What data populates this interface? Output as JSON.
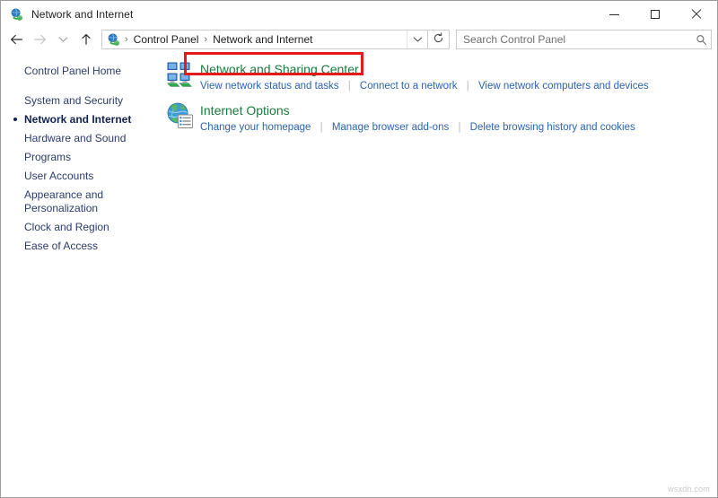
{
  "window": {
    "title": "Network and Internet",
    "title_icon": "network-globe-icon",
    "controls": {
      "minimize_label": "Minimize",
      "maximize_label": "Maximize",
      "close_label": "Close"
    }
  },
  "navbar": {
    "back_label": "Back",
    "forward_label": "Forward",
    "recent_label": "Recent locations",
    "up_label": "Up one level",
    "breadcrumb": {
      "icon": "network-globe-icon",
      "separator": "›",
      "items": [
        "Control Panel",
        "Network and Internet"
      ]
    },
    "address_dropdown_label": "Previous locations",
    "refresh_label": "Refresh",
    "search": {
      "placeholder": "Search Control Panel",
      "value": "",
      "icon": "search-icon"
    }
  },
  "sidebar": {
    "items": [
      {
        "label": "Control Panel Home",
        "current": false
      },
      {
        "label": "System and Security",
        "current": false
      },
      {
        "label": "Network and Internet",
        "current": true
      },
      {
        "label": "Hardware and Sound",
        "current": false
      },
      {
        "label": "Programs",
        "current": false
      },
      {
        "label": "User Accounts",
        "current": false
      },
      {
        "label": "Appearance and Personalization",
        "current": false
      },
      {
        "label": "Clock and Region",
        "current": false
      },
      {
        "label": "Ease of Access",
        "current": false
      }
    ]
  },
  "main": {
    "categories": [
      {
        "icon": "network-sharing-icon",
        "title": "Network and Sharing Center",
        "highlighted": true,
        "links": [
          "View network status and tasks",
          "Connect to a network",
          "View network computers and devices"
        ]
      },
      {
        "icon": "internet-options-globe-icon",
        "title": "Internet Options",
        "highlighted": false,
        "links": [
          "Change your homepage",
          "Manage browser add-ons",
          "Delete browsing history and cookies"
        ]
      }
    ]
  },
  "watermark": {
    "text": "wsxdn.com"
  },
  "colors": {
    "heading_green": "#1a7a3c",
    "link_blue": "#2b63b0",
    "sidebar_text": "#2b3c6b",
    "annotation_red": "#e51b1b",
    "window_border": "#9c9c9c"
  }
}
